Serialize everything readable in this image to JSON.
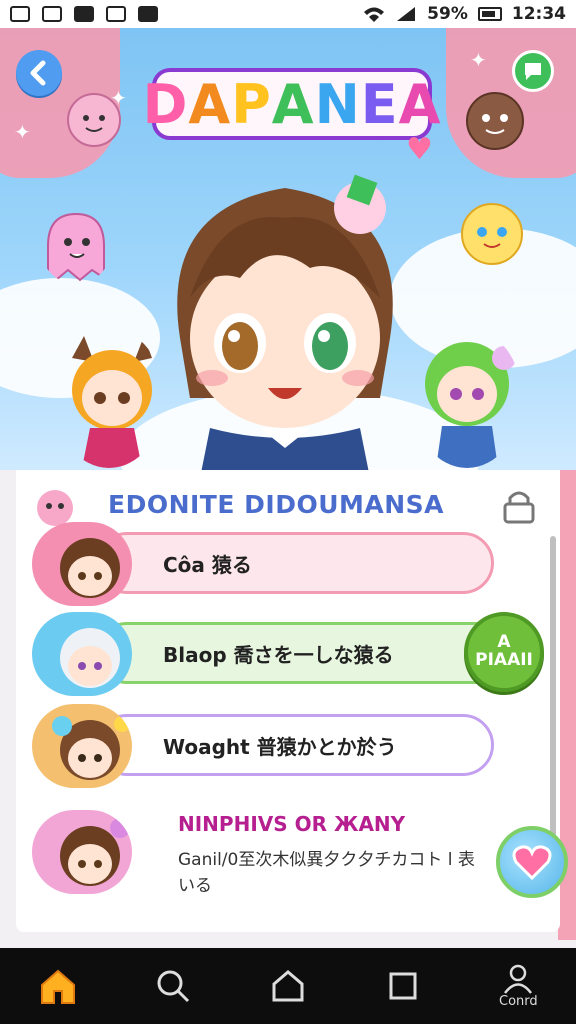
{
  "status_bar": {
    "battery": "59%",
    "time": "12:34"
  },
  "hero": {
    "logo": [
      "D",
      "A",
      "P",
      "A",
      "N",
      "E",
      "A"
    ],
    "back_icon": "chevron-left-icon",
    "share_icon": "speech-bubble-icon"
  },
  "panel": {
    "title": "EDONITE DIDOUMANSA",
    "rows": [
      {
        "label": "Côa 猿る",
        "color": "#f39bb3",
        "fill": "#fde6ec"
      },
      {
        "label": "Blaop 喬さを一しな猿る",
        "color": "#88d26a",
        "fill": "#e7f7df"
      },
      {
        "label": "Woaght 普猿かとか於う",
        "color": "#c3a1f0",
        "fill": "#ffffff"
      }
    ],
    "play_button": {
      "line1": "A",
      "line2": "PIAAII"
    },
    "news": {
      "title": "NINPHIVS OR ЖANY",
      "subtitle": "Ganil/0至次木似異夕ク夕チカコト l 表いる"
    }
  },
  "bottom_nav": {
    "account_label": "Conrd"
  },
  "colors": {
    "accent_blue": "#4a6ccc",
    "pink": "#f59ab0",
    "green": "#6fbf3a"
  }
}
